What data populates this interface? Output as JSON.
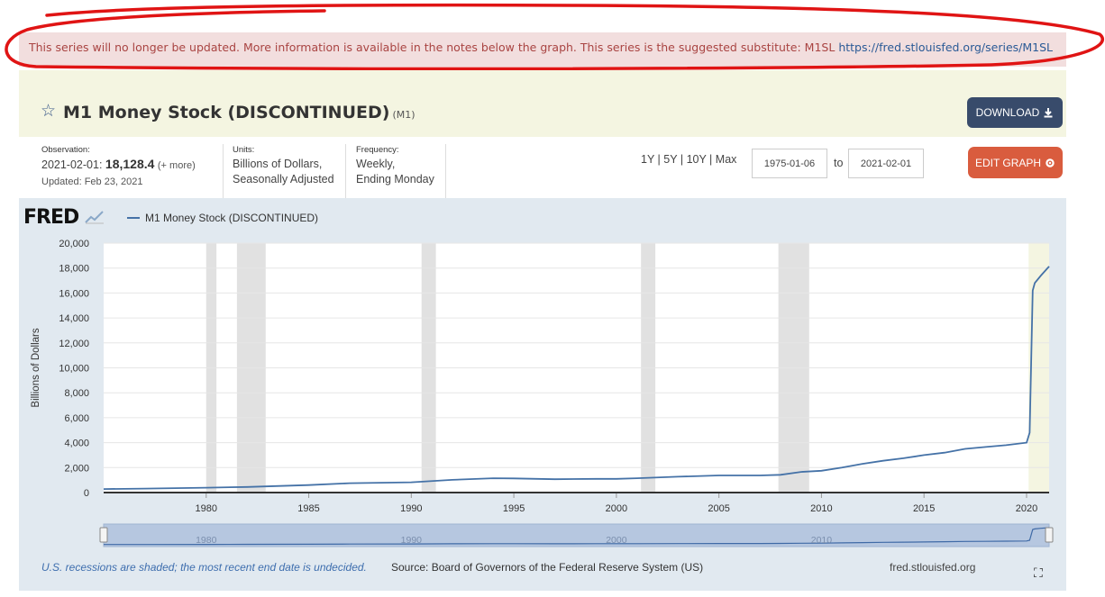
{
  "notice": {
    "text": "This series will no longer be updated. More information is available in the notes below the graph. This series is the suggested substitute: M1SL ",
    "link": "https://fred.stlouisfed.org/series/M1SL"
  },
  "header": {
    "title": "M1 Money Stock (DISCONTINUED)",
    "code": "(M1)",
    "download_label": "DOWNLOAD",
    "star_icon": "star-outline-icon",
    "download_icon": "download-icon"
  },
  "meta": {
    "observation_label": "Observation:",
    "observation_date": "2021-02-01:",
    "observation_value": "18,128.4",
    "observation_more": "(+ more)",
    "updated": "Updated: Feb 23, 2021",
    "units_label": "Units:",
    "units_line1": "Billions of Dollars,",
    "units_line2": "Seasonally Adjusted",
    "frequency_label": "Frequency:",
    "frequency_line1": "Weekly,",
    "frequency_line2": "Ending Monday",
    "range_options": [
      "1Y",
      "5Y",
      "10Y",
      "Max"
    ],
    "start_date": "1975-01-06",
    "to_label": "to",
    "end_date": "2021-02-01",
    "edit_label": "EDIT GRAPH",
    "edit_icon": "gear-icon"
  },
  "graph": {
    "logo_text": "FRED",
    "footer_note": "U.S. recessions are shaded; the most recent end date is undecided.",
    "source": "Source: Board of Governors of the Federal Reserve System (US)",
    "site": "fred.stlouisfed.org",
    "fullscreen_icon": "fullscreen-icon"
  },
  "chart_data": {
    "type": "line",
    "title": "",
    "legend": [
      "M1 Money Stock (DISCONTINUED)"
    ],
    "ylabel": "Billions of Dollars",
    "xlabel": "",
    "x_range": [
      1975.0,
      2021.1
    ],
    "ylim": [
      0,
      20000
    ],
    "y_ticks": [
      0,
      2000,
      4000,
      6000,
      8000,
      10000,
      12000,
      14000,
      16000,
      18000,
      20000
    ],
    "y_tick_labels": [
      "0",
      "2,000",
      "4,000",
      "6,000",
      "8,000",
      "10,000",
      "12,000",
      "14,000",
      "16,000",
      "18,000",
      "20,000"
    ],
    "x_ticks": [
      1980,
      1985,
      1990,
      1995,
      2000,
      2005,
      2010,
      2015,
      2020
    ],
    "x_tick_labels": [
      "1980",
      "1985",
      "1990",
      "1995",
      "2000",
      "2005",
      "2010",
      "2015",
      "2020"
    ],
    "grid": "horizontal",
    "recessions": [
      [
        1980.0,
        1980.5
      ],
      [
        1981.5,
        1982.9
      ],
      [
        1990.5,
        1991.2
      ],
      [
        2001.2,
        2001.9
      ],
      [
        2007.9,
        2009.4
      ],
      [
        2020.1,
        2021.1
      ]
    ],
    "series": [
      {
        "name": "M1 Money Stock (DISCONTINUED)",
        "color": "#4572a7",
        "x": [
          1975.0,
          1977,
          1980,
          1982,
          1985,
          1987,
          1990,
          1992,
          1994,
          1995,
          1997,
          1999,
          2000,
          2001,
          2003,
          2005,
          2007,
          2008,
          2009,
          2010,
          2011,
          2012,
          2013,
          2014,
          2015,
          2016,
          2017,
          2018,
          2019,
          2020.0,
          2020.15,
          2020.3,
          2020.4,
          2020.7,
          2021.1
        ],
        "values": [
          285,
          320,
          390,
          450,
          600,
          750,
          820,
          1020,
          1150,
          1130,
          1070,
          1100,
          1100,
          1150,
          1270,
          1370,
          1370,
          1420,
          1650,
          1750,
          2000,
          2300,
          2550,
          2750,
          3000,
          3200,
          3500,
          3650,
          3800,
          4000,
          4800,
          16200,
          16800,
          17400,
          18128
        ]
      }
    ],
    "navigator_labels": [
      "1980",
      "1990",
      "2000",
      "2010"
    ]
  }
}
